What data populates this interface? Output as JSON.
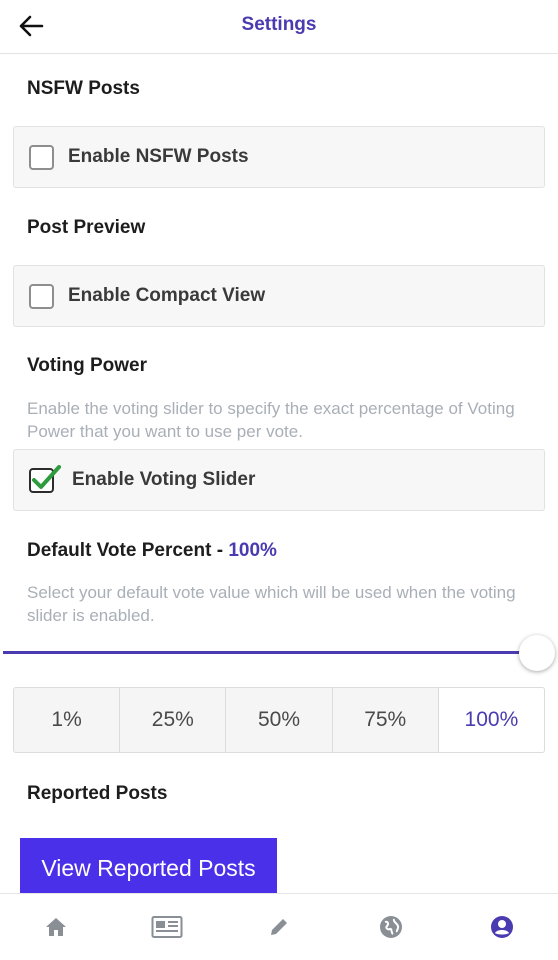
{
  "header": {
    "title": "Settings",
    "back_icon": "arrow-left-icon"
  },
  "nsfw": {
    "title": "NSFW Posts",
    "option_label": "Enable NSFW Posts",
    "checked": false
  },
  "preview": {
    "title": "Post Preview",
    "option_label": "Enable Compact View",
    "checked": false
  },
  "voting": {
    "title": "Voting Power",
    "description": "Enable the voting slider to specify the exact percentage of Voting Power that you want to use per vote.",
    "option_label": "Enable Voting Slider",
    "checked": true
  },
  "default_vote": {
    "title": "Default Vote Percent - ",
    "percent": "100%",
    "description": "Select your default vote value which will be used when the voting slider is enabled.",
    "slider_value": 1.0,
    "options": [
      "1%",
      "25%",
      "50%",
      "75%",
      "100%"
    ],
    "selected": "100%"
  },
  "reported": {
    "title": "Reported Posts",
    "button_label": "View Reported Posts"
  },
  "tabbar": {
    "items": [
      {
        "icon": "home-icon",
        "active": false
      },
      {
        "icon": "newspaper-icon",
        "active": false
      },
      {
        "icon": "pencil-icon",
        "active": false
      },
      {
        "icon": "globe-icon",
        "active": false
      },
      {
        "icon": "user-icon",
        "active": true
      }
    ]
  },
  "colors": {
    "accent": "#4a3bb0",
    "button": "#4a30e8",
    "check": "#2e9b3e",
    "muted": "#a9afb7"
  }
}
